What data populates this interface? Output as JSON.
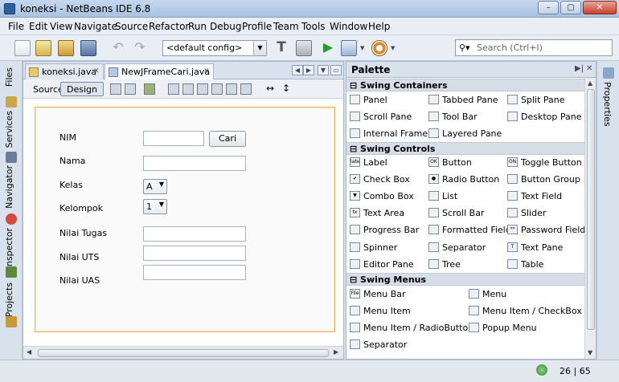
{
  "window": {
    "title": "koneksi - NetBeans IDE 6.8",
    "minimize": "–",
    "maximize": "▢",
    "close": "✕"
  },
  "menu": [
    "File",
    "Edit",
    "View",
    "Navigate",
    "Source",
    "Refactor",
    "Run",
    "Debug",
    "Profile",
    "Team",
    "Tools",
    "Window",
    "Help"
  ],
  "toolbar": {
    "config": "<default config>",
    "search_placeholder": "Search (Ctrl+I)"
  },
  "left_tabs": [
    "Files",
    "Services",
    "Navigator",
    "Inspector",
    "Projects"
  ],
  "right_tabs": [
    "Properties"
  ],
  "editor": {
    "tabs": [
      {
        "label": "koneksi.java"
      },
      {
        "label": "NewJFrameCari.java"
      }
    ],
    "mode_source": "Source",
    "mode_design": "Design"
  },
  "form": {
    "nim": "NIM",
    "cari": "Cari",
    "nama": "Nama",
    "kelas": "Kelas",
    "kelas_value": "A",
    "kelompok": "Kelompok",
    "kelompok_value": "1",
    "nilai_tugas": "Nilai Tugas",
    "nilai_uts": "Nilai UTS",
    "nilai_uas": "Nilai UAS"
  },
  "palette": {
    "title": "Palette",
    "categories": [
      {
        "name": "Swing Containers",
        "items": [
          "Panel",
          "Tabbed Pane",
          "Split Pane",
          "Scroll Pane",
          "Tool Bar",
          "Desktop Pane",
          "Internal Frame",
          "Layered Pane"
        ]
      },
      {
        "name": "Swing Controls",
        "items": [
          "Label",
          "Button",
          "Toggle Button",
          "Check Box",
          "Radio Button",
          "Button Group",
          "Combo Box",
          "List",
          "Text Field",
          "Text Area",
          "Scroll Bar",
          "Slider",
          "Progress Bar",
          "Formatted Field",
          "Password Field",
          "Spinner",
          "Separator",
          "Text Pane",
          "Editor Pane",
          "Tree",
          "Table"
        ]
      },
      {
        "name": "Swing Menus",
        "items": [
          "Menu Bar",
          "Menu",
          "Menu Item",
          "Menu Item / CheckBox",
          "Menu Item / RadioButton",
          "Popup Menu",
          "Separator"
        ]
      }
    ]
  },
  "status": {
    "position": "26 | 65"
  }
}
